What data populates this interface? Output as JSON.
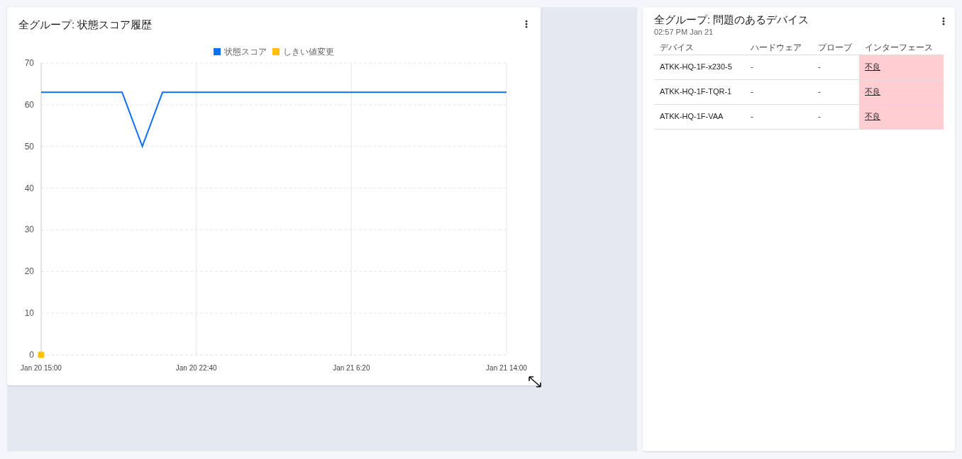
{
  "score_card": {
    "title": "全グループ: 状態スコア履歴",
    "chart_data": {
      "type": "line",
      "grid": true,
      "ylim": [
        0,
        70
      ],
      "categories": [
        "Jan 20 15:00",
        null,
        null,
        null,
        null,
        null,
        null,
        null,
        null,
        null,
        null,
        null,
        null,
        null,
        null,
        null,
        null,
        null,
        null,
        null,
        null,
        null,
        null,
        "Jan 20 22:40",
        null,
        null,
        null,
        null,
        null,
        null,
        null,
        null,
        null,
        null,
        null,
        null,
        null,
        null,
        null,
        null,
        null,
        null,
        null,
        null,
        null,
        null,
        "Jan 21 6:20",
        null,
        null,
        null,
        null,
        null,
        null,
        null,
        null,
        null,
        null,
        null,
        null,
        null,
        null,
        null,
        null,
        null,
        null,
        null,
        null,
        null,
        null,
        "Jan 21 14:00"
      ],
      "yticks": [
        0,
        10,
        20,
        30,
        40,
        50,
        60,
        70
      ],
      "series": [
        {
          "name": "状態スコア",
          "color": "#0d6efd",
          "values": [
            63,
            63,
            63,
            63,
            63,
            63,
            63,
            63,
            63,
            63,
            63,
            63,
            63,
            58.67,
            54.33,
            50,
            54.33,
            58.67,
            63,
            63,
            63,
            63,
            63,
            63,
            63,
            63,
            63,
            63,
            63,
            63,
            63,
            63,
            63,
            63,
            63,
            63,
            63,
            63,
            63,
            63,
            63,
            63,
            63,
            63,
            63,
            63,
            63,
            63,
            63,
            63,
            63,
            63,
            63,
            63,
            63,
            63,
            63,
            63,
            63,
            63,
            63,
            63,
            63,
            63,
            63,
            63,
            63,
            63,
            63,
            63
          ]
        },
        {
          "name": "しきい値変更",
          "color": "#ffc107",
          "marker": "square",
          "values": [
            0,
            null,
            null,
            null,
            null,
            null,
            null,
            null,
            null,
            null,
            null,
            null,
            null,
            null,
            null,
            null,
            null,
            null,
            null,
            null,
            null,
            null,
            null,
            null,
            null,
            null,
            null,
            null,
            null,
            null,
            null,
            null,
            null,
            null,
            null,
            null,
            null,
            null,
            null,
            null,
            null,
            null,
            null,
            null,
            null,
            null,
            null,
            null,
            null,
            null,
            null,
            null,
            null,
            null,
            null,
            null,
            null,
            null,
            null,
            null,
            null,
            null,
            null,
            null,
            null,
            null,
            null,
            null,
            null,
            null
          ]
        }
      ]
    }
  },
  "devices_card": {
    "title": "全グループ: 問題のあるデバイス",
    "timestamp": "02:57 PM Jan 21",
    "columns": [
      "デバイス",
      "ハードウェア",
      "プローブ",
      "インターフェース"
    ],
    "rows": [
      {
        "device": "ATKK-HQ-1F-x230-5",
        "hardware": "-",
        "probe": "-",
        "interface": {
          "text": "不良",
          "highlighted": true
        }
      },
      {
        "device": "ATKK-HQ-1F-TQR-1",
        "hardware": "-",
        "probe": "-",
        "interface": {
          "text": "不良",
          "highlighted": true
        }
      },
      {
        "device": "ATKK-HQ-1F-VAA",
        "hardware": "-",
        "probe": "-",
        "interface": {
          "text": "不良",
          "highlighted": true
        }
      }
    ]
  }
}
